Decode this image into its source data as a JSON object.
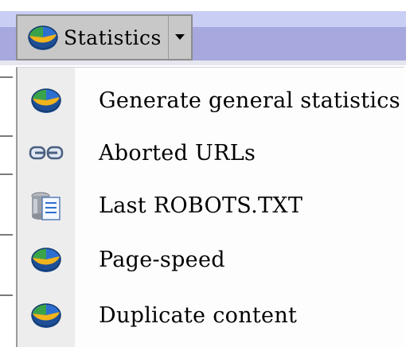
{
  "toolbar": {
    "button_label": "Statistics",
    "button_icon": "pie-chart-icon",
    "arrow_icon": "dropdown-arrow-icon"
  },
  "menu": {
    "items": [
      {
        "label": "Generate general statistics",
        "icon": "pie-chart-icon"
      },
      {
        "label": "Aborted URLs",
        "icon": "broken-link-icon"
      },
      {
        "label": "Last ROBOTS.TXT",
        "icon": "robots-file-icon"
      },
      {
        "label": "Page-speed",
        "icon": "pie-chart-icon"
      },
      {
        "label": "Duplicate content",
        "icon": "pie-chart-icon"
      }
    ]
  },
  "colors": {
    "toolbar_top": "#c9cef5",
    "toolbar_main": "#a7a8dd",
    "button_bg": "#c8c8c8",
    "menu_bg": "#fdfdfd",
    "icon_gutter": "#ededed",
    "pie_green": "#3aa34a",
    "pie_blue": "#2c6fd1",
    "pie_yellow": "#f2b41c"
  }
}
